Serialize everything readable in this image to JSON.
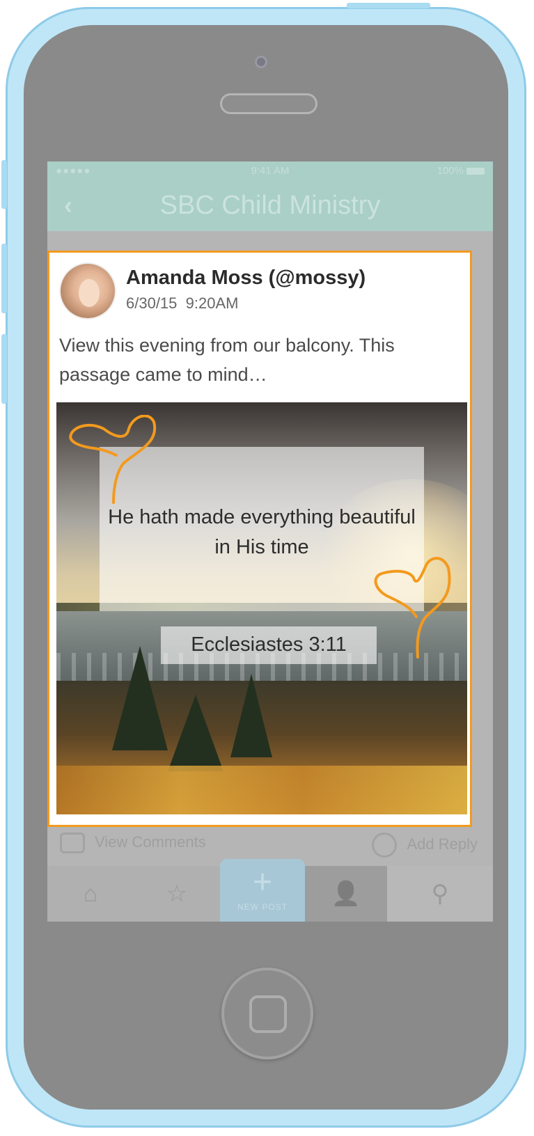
{
  "status_bar": {
    "signal": "●●●●●",
    "time": "9:41 AM",
    "battery": "100%"
  },
  "nav": {
    "back_icon": "‹",
    "title": "SBC Child Ministry"
  },
  "post": {
    "author": "Amanda Moss (@mossy)",
    "date": "6/30/15",
    "time": "9:20AM",
    "text": "View this evening from our balcony.  This passage came to mind…",
    "image": {
      "quote": "He hath made everything beautiful in His time",
      "reference": "Ecclesiastes 3:11"
    }
  },
  "actions": {
    "view_comments": "View Comments",
    "add_reply": "Add Reply"
  },
  "tabs": {
    "new_post": "NEW POST",
    "new_post_icon": "+",
    "home_icon": "⌂",
    "favorites_icon": "☆",
    "profile_icon": "👤",
    "search_icon": "⚲"
  },
  "colors": {
    "highlight": "#f39a1e",
    "nav_bg": "#a9cfc6",
    "new_post_bg": "#a7c7d6",
    "phone_shell": "#bfe6f7"
  }
}
